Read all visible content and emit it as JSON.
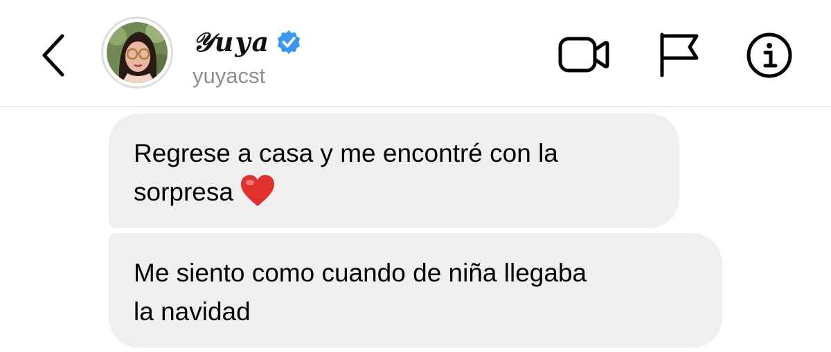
{
  "header": {
    "display_name": "𝒴uya",
    "username": "yuyacst",
    "icons": {
      "back": "chevron-left-icon",
      "verified": "verified-badge-icon",
      "video": "video-call-icon",
      "flag": "flag-icon",
      "info": "info-icon"
    },
    "verified_color": "#3897f0"
  },
  "messages": [
    {
      "lines": [
        "Regrese a casa y me encontré con la",
        "sorpresa"
      ],
      "emoji": "heart-emoji"
    },
    {
      "lines": [
        "Me siento como cuando de niña llegaba",
        "la navidad"
      ]
    }
  ],
  "colors": {
    "bubble_bg": "#efefef",
    "username": "#8e8e8e",
    "divider": "#dbdbdb",
    "heart": "#e0312f"
  }
}
